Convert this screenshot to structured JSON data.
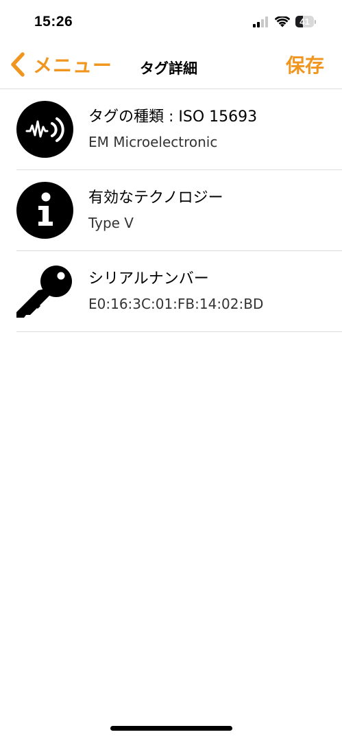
{
  "status_bar": {
    "time": "15:26",
    "battery_level": "41",
    "battery_fraction": 0.41,
    "signal_bars_active": 2,
    "signal_bars_total": 4
  },
  "nav": {
    "back_label": "メニュー",
    "title": "タグ詳細",
    "save_label": "保存"
  },
  "colors": {
    "accent": "#f0961e",
    "divider": "#dcdcdc",
    "icon": "#000000"
  },
  "rows": [
    {
      "icon": "nfc-signal-icon",
      "title": "タグの種類 : ISO 15693",
      "subtitle": "EM Microelectronic"
    },
    {
      "icon": "info-icon",
      "title": "有効なテクノロジー",
      "subtitle": "Type V"
    },
    {
      "icon": "key-icon",
      "title": "シリアルナンバー",
      "subtitle": "E0:16:3C:01:FB:14:02:BD"
    }
  ]
}
